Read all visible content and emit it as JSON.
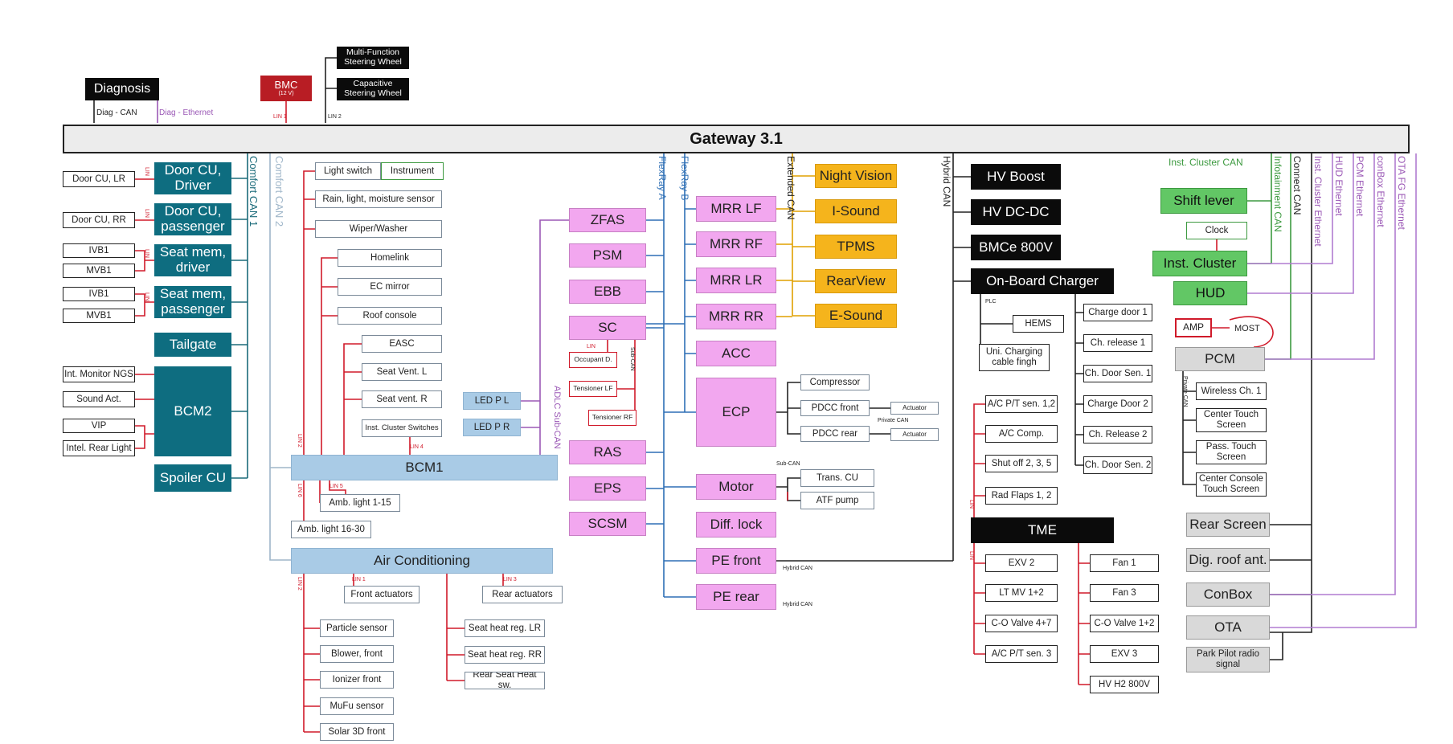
{
  "colors": {
    "teal": "#0e6d80",
    "black": "#0b0b0b",
    "pink": "#f2a7ef",
    "orange": "#f5b41c",
    "light_blue": "#a9cbe6",
    "green": "#62c765",
    "grey": "#d9d9d9",
    "red": "#d01a2a",
    "purple": "#9b59b6",
    "blue": "#2e6fb5",
    "dark_teal": "#1b6b7a",
    "ethernet_purple": "#b07cd0"
  },
  "boxes": {
    "gateway": "Gateway 3.1",
    "diagnosis": "Diagnosis",
    "bmc": "BMC",
    "bmc_sub": "(12 V)",
    "mfsw": "Multi-Function Steering Wheel",
    "capsw": "Capacitive Steering Wheel",
    "door_cu_driver": "Door CU, Driver",
    "door_cu_passenger": "Door CU, passenger",
    "seat_mem_driver": "Seat mem, driver",
    "seat_mem_passenger": "Seat mem, passenger",
    "tailgate": "Tailgate",
    "bcm2": "BCM2",
    "spoiler_cu": "Spoiler CU",
    "door_cu_lr": "Door CU, LR",
    "door_cu_rr": "Door CU, RR",
    "ivb1_a": "IVB1",
    "mvb1_a": "MVB1",
    "ivb1_b": "IVB1",
    "mvb1_b": "MVB1",
    "int_monitor": "Int. Monitor NGS",
    "sound_act": "Sound Act.",
    "vip": "VIP",
    "intel_rear": "Intel. Rear Light",
    "light_switch": "Light switch",
    "instrument": "Instrument",
    "rain_sensor": "Rain, light, moisture sensor",
    "wiper": "Wiper/Washer",
    "homelink": "Homelink",
    "ec_mirror": "EC mirror",
    "roof_console": "Roof console",
    "easc": "EASC",
    "seat_vent_l": "Seat Vent. L",
    "seat_vent_r": "Seat vent. R",
    "inst_cluster_switches": "Inst. Cluster Switches",
    "bcm1": "BCM1",
    "amb_light_1": "Amb. light 1-15",
    "amb_light_16": "Amb. light 16-30",
    "air_conditioning": "Air Conditioning",
    "front_actuators": "Front actuators",
    "rear_actuators": "Rear actuators",
    "particle_sensor": "Particle sensor",
    "blower_front": "Blower, front",
    "ionizer_front": "Ionizer front",
    "mufu_sensor": "MuFu sensor",
    "solar_3d": "Solar 3D front",
    "seat_heat_lr": "Seat heat reg. LR",
    "seat_heat_rr": "Seat heat reg. RR",
    "rear_seat_heat": "Rear Seat Heat sw.",
    "led_pl": "LED P L",
    "led_pr": "LED P R",
    "zfas": "ZFAS",
    "psm": "PSM",
    "ebb": "EBB",
    "sc": "SC",
    "occupant_d": "Occupant D.",
    "tensioner_lf": "Tensioner LF",
    "tensioner_rf": "Tensioner RF",
    "ras": "RAS",
    "eps": "EPS",
    "scsm": "SCSM",
    "mrr_lf": "MRR LF",
    "mrr_rf": "MRR RF",
    "mrr_lr": "MRR LR",
    "mrr_rr": "MRR RR",
    "acc": "ACC",
    "ecp": "ECP",
    "motor": "Motor",
    "diff_lock": "Diff. lock",
    "pe_front": "PE front",
    "pe_rear": "PE rear",
    "night_vision": "Night Vision",
    "i_sound": "I-Sound",
    "tpms": "TPMS",
    "rearview": "RearView",
    "e_sound": "E-Sound",
    "compressor": "Compressor",
    "pdcc_front": "PDCC front",
    "pdcc_rear": "PDCC rear",
    "actuator_1": "Actuator",
    "actuator_2": "Actuator",
    "trans_cu": "Trans. CU",
    "atf_pump": "ATF pump",
    "hv_boost": "HV Boost",
    "hv_dcdc": "HV DC-DC",
    "bmce": "BMCe 800V",
    "obc": "On-Board Charger",
    "hems": "HEMS",
    "uni_charging": "Uni. Charging cable fingh",
    "charge_door_1": "Charge door 1",
    "ch_release_1": "Ch. release 1",
    "ch_door_sen_1": "Ch. Door Sen. 1",
    "charge_door_2": "Charge Door 2",
    "ch_release_2": "Ch. Release 2",
    "ch_door_sen_2": "Ch. Door Sen. 2",
    "ac_pt_sen_12": "A/C P/T sen. 1,2",
    "ac_comp": "A/C Comp.",
    "shut_off": "Shut off 2, 3, 5",
    "rad_flaps": "Rad Flaps 1, 2",
    "tme": "TME",
    "exv2": "EXV 2",
    "lt_mv": "LT MV 1+2",
    "co_valve_47": "C-O Valve 4+7",
    "ac_pt_sen_3": "A/C P/T sen. 3",
    "fan1": "Fan 1",
    "fan3": "Fan 3",
    "co_valve_12": "C-O Valve 1+2",
    "exv3": "EXV 3",
    "hv_h2": "HV H2 800V",
    "shift_lever": "Shift lever",
    "clock": "Clock",
    "inst_cluster": "Inst. Cluster",
    "hud": "HUD",
    "amp": "AMP",
    "most": "MOST",
    "pcm": "PCM",
    "wireless_ch": "Wireless Ch. 1",
    "center_touch": "Center Touch Screen",
    "pass_touch": "Pass. Touch Screen",
    "center_console": "Center Console Touch Screen",
    "rear_screen": "Rear Screen",
    "dig_roof": "Dig. roof ant.",
    "conbox": "ConBox",
    "ota": "OTA",
    "park_pilot": "Park Pilot radio signal"
  },
  "bus_labels": {
    "diag_can": "Diag - CAN",
    "diag_eth": "Diag - Ethernet",
    "lin1_bmc": "LIN 1",
    "lin2_sw": "LIN 2",
    "comfort_can1": "Comfort CAN 1",
    "comfort_can2": "Comfort CAN 2",
    "flexray_a": "FlexRay A",
    "flexray_b": "FlexRay B",
    "extended_can": "Extended CAN",
    "hybrid_can": "Hybrid CAN",
    "inst_cluster_can": "Inst. Cluster CAN",
    "infotainment_can": "Infotainment CAN",
    "connect_can": "Connect CAN",
    "inst_cluster_eth": "Inst. Cluster Ethernet",
    "hud_eth": "HUD Ethernet",
    "pcm_eth": "PCM Ethernet",
    "conbox_eth": "conBox Ethernet",
    "ota_eth": "OTA FG Ethernet",
    "adlc_sub_can": "ADLC Sub-CAN",
    "sub_can_sc": "Sub-CAN",
    "sub_can_ecp": "Sub-CAN",
    "sub_can_motor": "Sub-CAN",
    "private_can_ecp": "Private CAN",
    "private_can_pcm": "Private CAN",
    "plc": "PLC",
    "hybrid_can_pe1": "Hybrid CAN",
    "hybrid_can_pe2": "Hybrid CAN",
    "lin": "LIN",
    "lin1": "LIN 1",
    "lin2": "LIN 2",
    "lin3": "LIN 3",
    "lin4": "LIN 4",
    "lin5": "LIN 5",
    "lin6": "LIN 6"
  }
}
